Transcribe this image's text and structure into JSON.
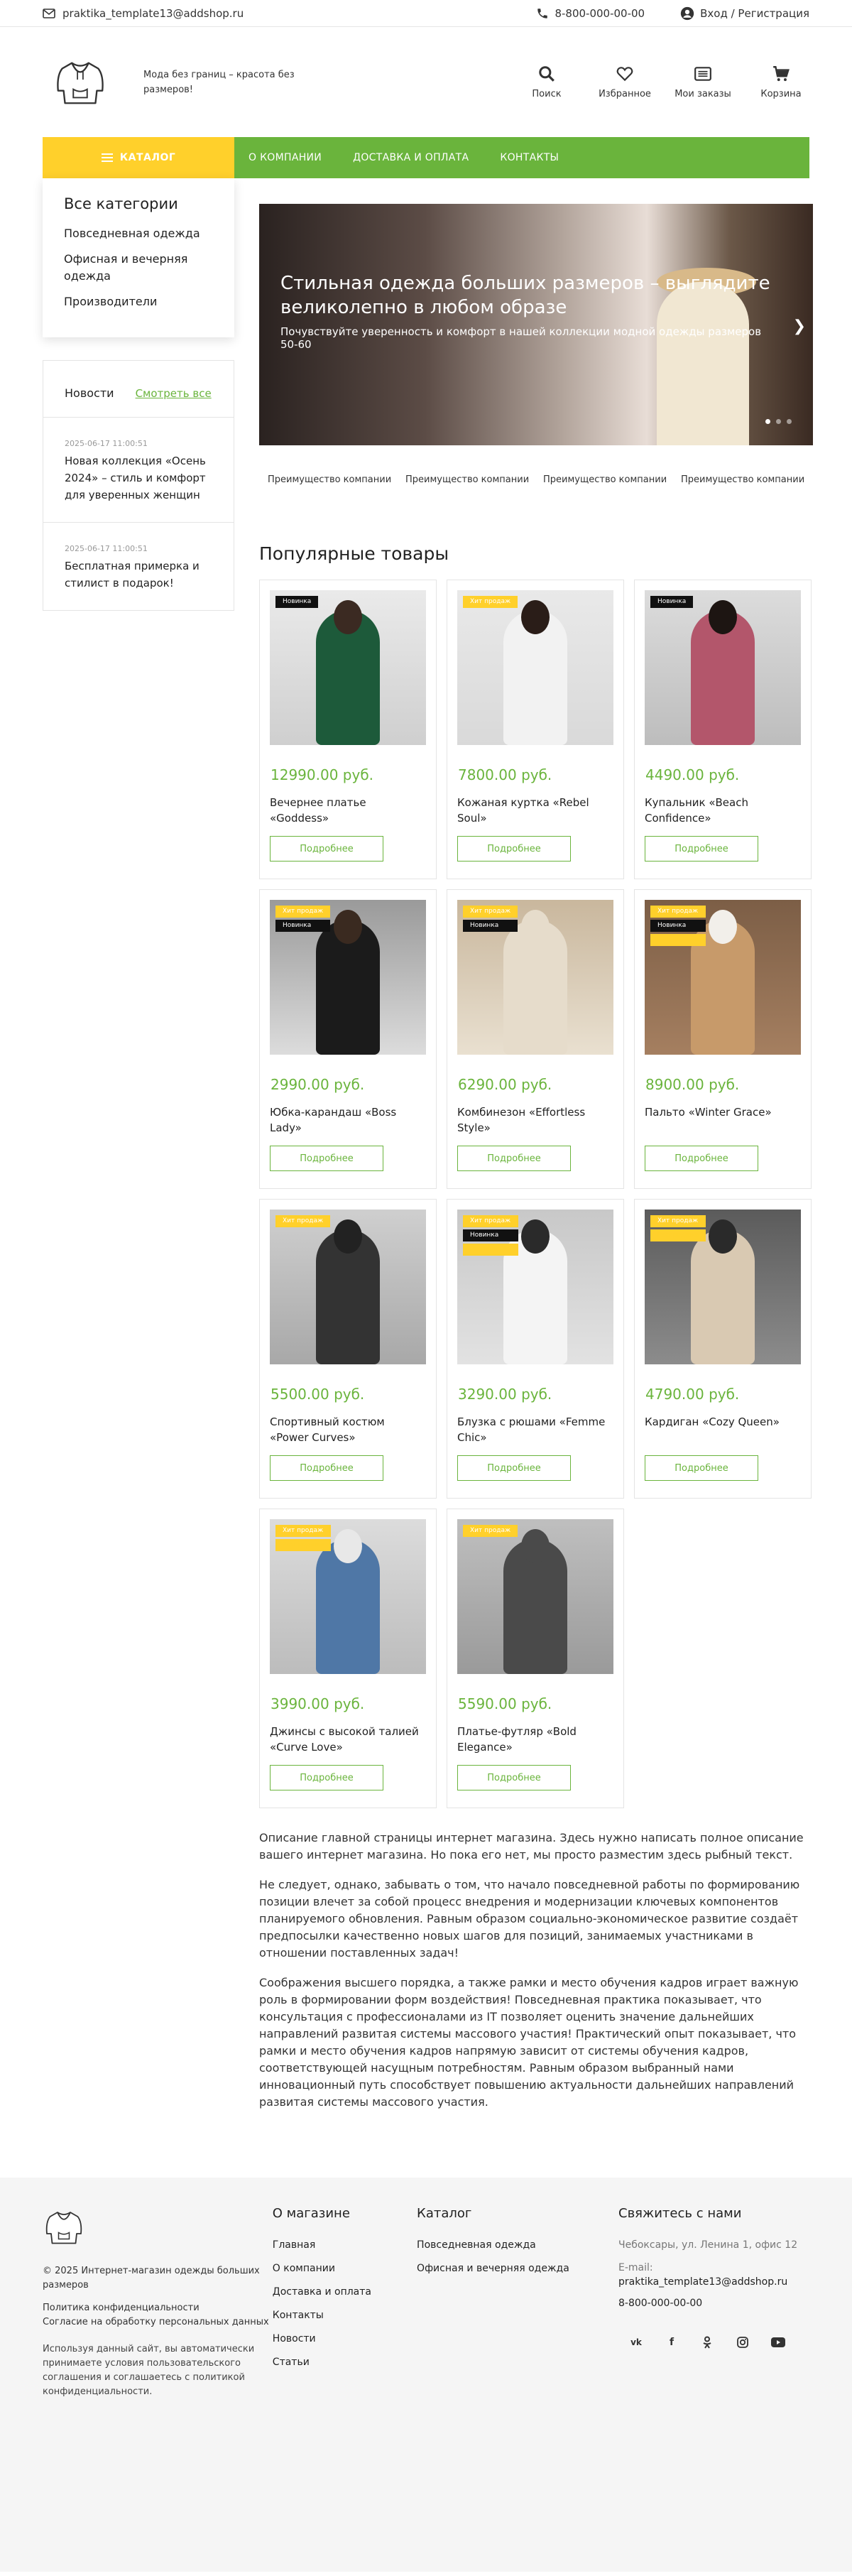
{
  "topbar": {
    "email": "praktika_template13@addshop.ru",
    "phone": "8-800-000-00-00",
    "login": "Вход / Регистрация"
  },
  "header": {
    "tagline": "Мода без границ – красота без размеров!",
    "icons": [
      {
        "label": "Поиск",
        "icon": "search-icon"
      },
      {
        "label": "Избранное",
        "icon": "heart-icon"
      },
      {
        "label": "Мои заказы",
        "icon": "orders-icon"
      },
      {
        "label": "Корзина",
        "icon": "cart-icon"
      }
    ]
  },
  "nav": {
    "catalog": "КАТАЛОГ",
    "links": [
      "О КОМПАНИИ",
      "ДОСТАВКА И ОПЛАТА",
      "КОНТАКТЫ"
    ]
  },
  "sidebar": {
    "title": "Все категории",
    "categories": [
      "Повседневная одежда",
      "Офисная и вечерняя одежда",
      "Производители"
    ],
    "news_title": "Новости",
    "news_all": "Смотреть все",
    "news": [
      {
        "date": "2025-06-17 11:00:51",
        "title": "Новая коллекция «Осень 2024» – стиль и комфорт для уверенных женщин"
      },
      {
        "date": "2025-06-17 11:00:51",
        "title": "Бесплатная примерка и стилист в подарок!"
      }
    ]
  },
  "slider": {
    "heading": "Стильная одежда больших размеров – выглядите великолепно в любом образе",
    "subheading": "Почувствуйте уверенность и комфорт в нашей коллекции модной одежды размеров 50-60"
  },
  "advantages": [
    "Преимущество компании",
    "Преимущество компании",
    "Преимущество компании",
    "Преимущество компании"
  ],
  "popular": {
    "title": "Популярные товары",
    "more_label": "Подробнее",
    "products": [
      {
        "price": "12990.00 руб.",
        "name": "Вечернее платье «Goddess»",
        "badges": [
          "Новинка"
        ]
      },
      {
        "price": "7800.00 руб.",
        "name": "Кожаная куртка «Rebel Soul»",
        "badges": [
          "Хит продаж"
        ]
      },
      {
        "price": "4490.00 руб.",
        "name": "Купальник «Beach Confidence»",
        "badges": [
          "Новинка"
        ]
      },
      {
        "price": "2990.00 руб.",
        "name": "Юбка-карандаш «Boss Lady»",
        "badges": [
          "Хит продаж",
          "Новинка"
        ]
      },
      {
        "price": "6290.00 руб.",
        "name": "Комбинезон «Effortless Style»",
        "badges": [
          "Хит продаж",
          "Новинка"
        ]
      },
      {
        "price": "8900.00 руб.",
        "name": "Пальто «Winter Grace»",
        "badges": [
          "Хит продаж",
          "Новинка",
          "Распродажа"
        ]
      },
      {
        "price": "5500.00 руб.",
        "name": "Спортивный костюм «Power Curves»",
        "badges": [
          "Хит продаж"
        ]
      },
      {
        "price": "3290.00 руб.",
        "name": "Блузка с рюшами «Femme Chic»",
        "badges": [
          "Хит продаж",
          "Новинка",
          "Распродажа"
        ]
      },
      {
        "price": "4790.00 руб.",
        "name": "Кардиган «Cozy Queen»",
        "badges": [
          "Хит продаж",
          "Распродажа"
        ]
      },
      {
        "price": "3990.00 руб.",
        "name": "Джинсы с высокой талией «Curve Love»",
        "badges": [
          "Хит продаж",
          "Распродажа"
        ]
      },
      {
        "price": "5590.00 руб.",
        "name": "Платье-футляр «Bold Elegance»",
        "badges": [
          "Хит продаж"
        ]
      }
    ]
  },
  "description": [
    "Описание главной страницы интернет магазина. Здесь нужно написать полное описание вашего интернет магазина. Но пока его нет, мы просто разместим здесь рыбный текст.",
    "Не следует, однако, забывать о том, что начало повседневной работы по формированию позиции влечет за собой процесс внедрения и модернизации ключевых компонентов планируемого обновления. Равным образом социально-экономическое развитие создаёт предпосылки качественно новых шагов для позиций, занимаемых участниками в отношении поставленных задач!",
    "Соображения высшего порядка, а также рамки и место обучения кадров играет важную роль в формировании форм воздействия! Повседневная практика показывает, что консультация с профессионалами из IT позволяет оценить значение дальнейших направлений развитая системы массового участия! Практический опыт показывает, что рамки и место обучения кадров напрямую зависит от системы обучения кадров, соответствующей насущным потребностям. Равным образом выбранный нами инновационный путь способствует повышению актуальности дальнейших направлений развитая системы массового участия."
  ],
  "footer": {
    "copyright": "© 2025 Интернет-магазин одежды больших размеров",
    "policy": "Политика конфиденциальности",
    "consent": "Согласие на обработку персональных данных",
    "note": "Используя данный сайт, вы автоматически принимаете условия пользовательского соглашения и соглашаетесь с политикой конфиденциальности.",
    "about_title": "О магазине",
    "about_links": [
      "Главная",
      "О компании",
      "Доставка и оплата",
      "Контакты",
      "Новости",
      "Статьи"
    ],
    "catalog_title": "Каталог",
    "catalog_links": [
      "Повседневная одежда",
      "Офисная и вечерняя одежда"
    ],
    "contact_title": "Свяжитесь с нами",
    "address": "Чебоксары, ул. Ленина 1, офис 12",
    "email_label": "E-mail:",
    "email": "praktika_template13@addshop.ru",
    "phone": "8-800-000-00-00",
    "social": [
      "vk-icon",
      "facebook-icon",
      "odnoklassniki-icon",
      "instagram-icon",
      "youtube-icon"
    ]
  },
  "colors": {
    "accent_green": "#6ab43c",
    "accent_yellow": "#ffd02b"
  }
}
